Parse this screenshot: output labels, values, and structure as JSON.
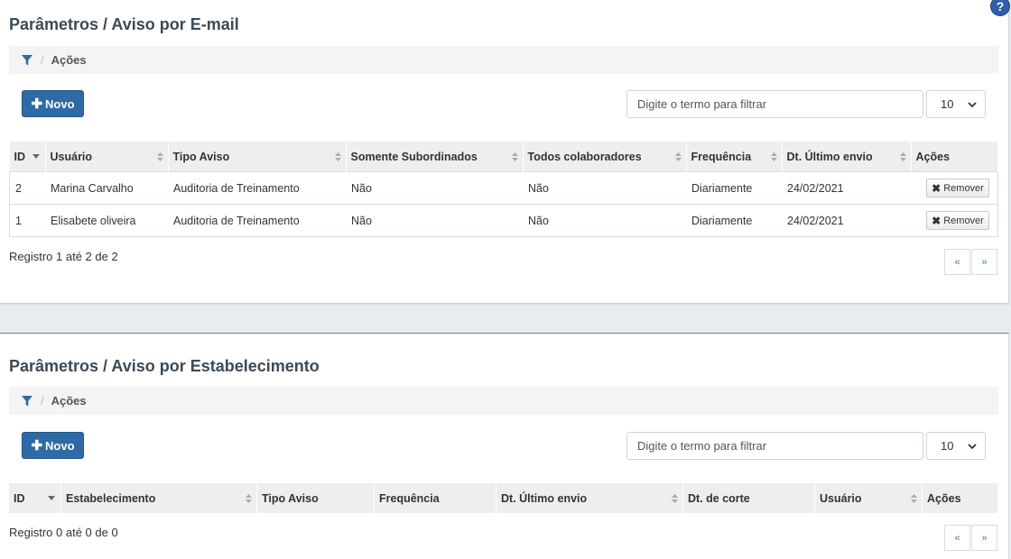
{
  "help_label": "?",
  "email_section": {
    "title": "Parâmetros / Aviso por E-mail",
    "breadcrumb": {
      "sep": "/",
      "label": "Ações"
    },
    "new_button": "Novo",
    "search_placeholder": "Digite o termo para filtrar",
    "page_size": "10",
    "columns": [
      "ID",
      "Usuário",
      "Tipo Aviso",
      "Somente Subordinados",
      "Todos colaboradores",
      "Frequência",
      "Dt. Último envio",
      "Ações"
    ],
    "rows": [
      {
        "id": "2",
        "usuario": "Marina Carvalho",
        "tipo": "Auditoria de Treinamento",
        "subordinados": "Não",
        "todos": "Não",
        "frequencia": "Diariamente",
        "data": "24/02/2021",
        "acao": "Remover"
      },
      {
        "id": "1",
        "usuario": "Elisabete oliveira",
        "tipo": "Auditoria de Treinamento",
        "subordinados": "Não",
        "todos": "Não",
        "frequencia": "Diariamente",
        "data": "24/02/2021",
        "acao": "Remover"
      }
    ],
    "registro": "Registro 1 até 2 de 2",
    "pager": {
      "prev": "«",
      "next": "»"
    }
  },
  "estab_section": {
    "title": "Parâmetros / Aviso por Estabelecimento",
    "breadcrumb": {
      "sep": "/",
      "label": "Ações"
    },
    "new_button": "Novo",
    "search_placeholder": "Digite o termo para filtrar",
    "page_size": "10",
    "columns": [
      "ID",
      "Estabelecimento",
      "Tipo Aviso",
      "Frequência",
      "Dt. Último envio",
      "Dt. de corte",
      "Usuário",
      "Ações"
    ],
    "registro": "Registro 0 até 0 de 0",
    "pager": {
      "prev": "«",
      "next": "»"
    }
  },
  "colors": {
    "primary": "#2e6aa6",
    "title": "#3b4a56",
    "row_border": "#cfe3e0",
    "header_bg": "#eeeeee"
  }
}
